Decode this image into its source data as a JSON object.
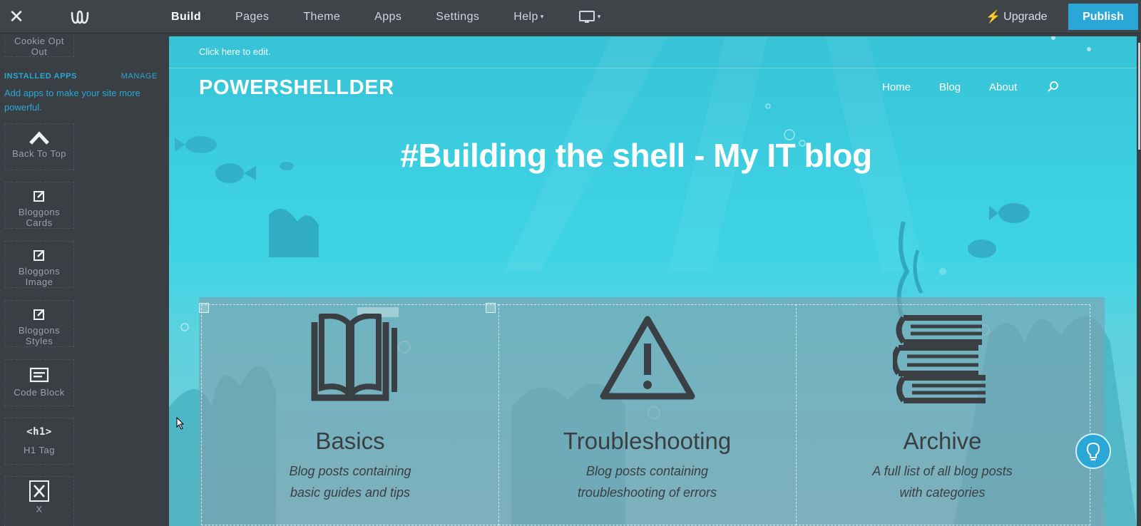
{
  "topbar": {
    "close_icon": "close-icon",
    "logo_icon": "weebly-logo-icon",
    "nav": [
      {
        "label": "Build",
        "active": true
      },
      {
        "label": "Pages"
      },
      {
        "label": "Theme"
      },
      {
        "label": "Apps"
      },
      {
        "label": "Settings"
      },
      {
        "label": "Help",
        "has_caret": true
      }
    ],
    "device_icon": "desktop-monitor-icon",
    "upgrade_label": "Upgrade",
    "publish_label": "Publish",
    "accent_color": "#2aa7d6"
  },
  "sidebar": {
    "partial_tile_label": "Cookie Opt Out",
    "installed_apps": {
      "title": "INSTALLED APPS",
      "manage_label": "MANAGE",
      "description": "Add apps to make your site more powerful."
    },
    "apps": [
      {
        "label": "Back To Top",
        "icon": "chevron-up-icon"
      },
      {
        "label": "Bloggons Cards",
        "icon": "edit-icon"
      },
      {
        "label": "Bloggons Image",
        "icon": "edit-icon"
      },
      {
        "label": "Bloggons Styles",
        "icon": "edit-icon"
      },
      {
        "label": "Code Block",
        "icon": "code-block-icon"
      },
      {
        "label": "H1 Tag",
        "icon_text": "<h1>"
      },
      {
        "label": "X",
        "icon": "x-box-icon"
      }
    ]
  },
  "site": {
    "click_to_edit": "Click here to edit.",
    "title": "POWERSHELLDER",
    "nav": [
      "Home",
      "Blog",
      "About"
    ],
    "search_icon": "search-icon",
    "hero_title": "#Building the shell - My IT blog",
    "features": [
      {
        "title": "Basics",
        "desc_line1": "Blog posts containing",
        "desc_line2": "basic guides and tips",
        "icon": "open-book-icon"
      },
      {
        "title": "Troubleshooting",
        "desc_line1": "Blog posts containing",
        "desc_line2": "troubleshooting of errors",
        "icon": "warning-triangle-icon"
      },
      {
        "title": "Archive",
        "desc_line1": "A full list of all blog posts",
        "desc_line2": "with categories",
        "icon": "book-stack-icon"
      }
    ],
    "help_bulb_icon": "lightbulb-icon"
  }
}
